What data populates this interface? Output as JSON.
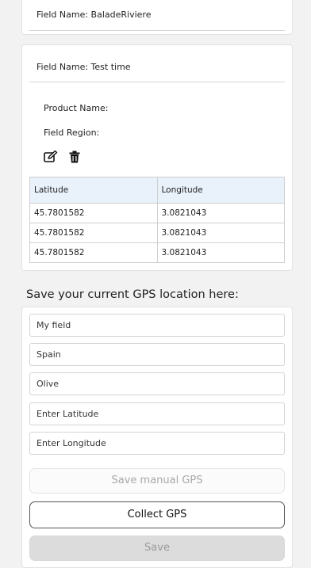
{
  "fields": [
    {
      "title": "Field Name: BaladeRiviere"
    },
    {
      "title": "Field Name: Test time",
      "product_label": "Product Name:",
      "region_label": "Field Region:",
      "table": {
        "headers": [
          "Latitude",
          "Longitude"
        ],
        "rows": [
          [
            "45.7801582",
            "3.0821043"
          ],
          [
            "45.7801582",
            "3.0821043"
          ],
          [
            "45.7801582",
            "3.0821043"
          ]
        ]
      }
    }
  ],
  "gps_form": {
    "title": "Save your current GPS location here:",
    "field_name_value": "My field",
    "region_value": "Spain",
    "product_value": "Olive",
    "latitude_placeholder": "Enter Latitude",
    "longitude_placeholder": "Enter Longitude",
    "save_manual_label": "Save manual GPS",
    "collect_label": "Collect GPS",
    "save_label": "Save"
  },
  "icons": {
    "edit": "edit-icon",
    "delete": "trash-icon"
  },
  "colors": {
    "table_header_bg": "#e9f1fb",
    "page_bg": "#f2f2f2"
  }
}
